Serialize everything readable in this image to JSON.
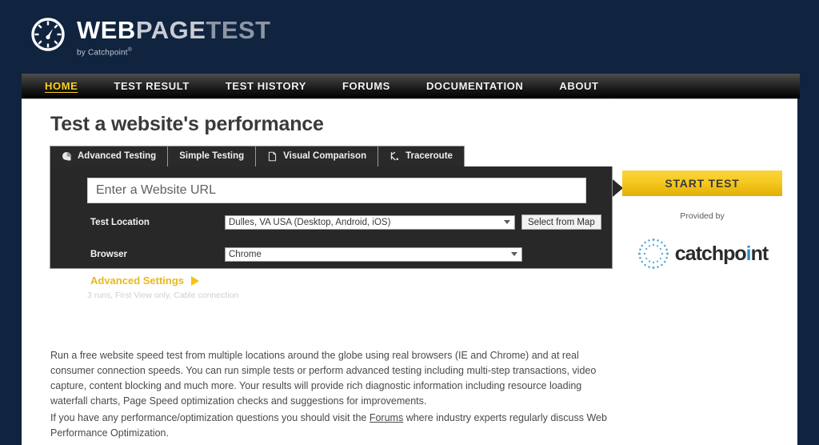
{
  "brand": {
    "logo_icon": "speedometer-gauge-icon",
    "name_part1": "WEB",
    "name_part2": "PAGE",
    "name_part3": "TEST",
    "tagline": "by Catchpoint",
    "tagline_mark": "®"
  },
  "nav": {
    "items": [
      {
        "label": "HOME",
        "active": true
      },
      {
        "label": "TEST RESULT",
        "active": false
      },
      {
        "label": "TEST HISTORY",
        "active": false
      },
      {
        "label": "FORUMS",
        "active": false
      },
      {
        "label": "DOCUMENTATION",
        "active": false
      },
      {
        "label": "ABOUT",
        "active": false
      }
    ]
  },
  "page": {
    "title": "Test a website's performance"
  },
  "tabs": [
    {
      "label": "Advanced Testing",
      "icon": "pie-chart-icon",
      "active": true
    },
    {
      "label": "Simple Testing",
      "icon": "none",
      "active": false
    },
    {
      "label": "Visual Comparison",
      "icon": "page-document-icon",
      "active": false
    },
    {
      "label": "Traceroute",
      "icon": "branching-path-icon",
      "active": false
    }
  ],
  "form": {
    "url_placeholder": "Enter a Website URL",
    "url_value": "",
    "location_label": "Test Location",
    "location_value": "Dulles, VA USA (Desktop, Android, iOS)",
    "location_options": [
      "Dulles, VA USA (Desktop, Android, iOS)"
    ],
    "select_from_map_label": "Select from Map",
    "browser_label": "Browser",
    "browser_value": "Chrome",
    "browser_options": [
      "Chrome"
    ],
    "advanced_settings_label": "Advanced Settings",
    "advanced_settings_arrow": "right-triangle-icon",
    "advanced_settings_summary": "3 runs, First View only, Cable connection"
  },
  "sidebar": {
    "start_test_label": "START TEST",
    "provided_by_label": "Provided by",
    "partner_logo_icon": "catchpoint-burst-icon",
    "partner_name_a": "catchpo",
    "partner_name_dot": "i",
    "partner_name_b": "nt"
  },
  "copy": {
    "paragraph_1": "Run a free website speed test from multiple locations around the globe using real browsers (IE and Chrome) and at real consumer connection speeds. You can run simple tests or perform advanced testing including multi-step transactions, video capture, content blocking and much more. Your results will provide rich diagnostic information including resource loading waterfall charts, Page Speed optimization checks and suggestions for improvements.",
    "paragraph_2_before": "If you have any performance/optimization questions you should visit the ",
    "paragraph_2_link": "Forums",
    "paragraph_2_after": " where industry experts regularly discuss Web Performance Optimization."
  },
  "colors": {
    "page_background": "#10233f",
    "nav_highlight": "#ffd21f",
    "accent_gold": "#e8b81e",
    "panel_dark": "#282828",
    "content_background": "#ffffff",
    "partner_blue": "#2b8fd4"
  }
}
